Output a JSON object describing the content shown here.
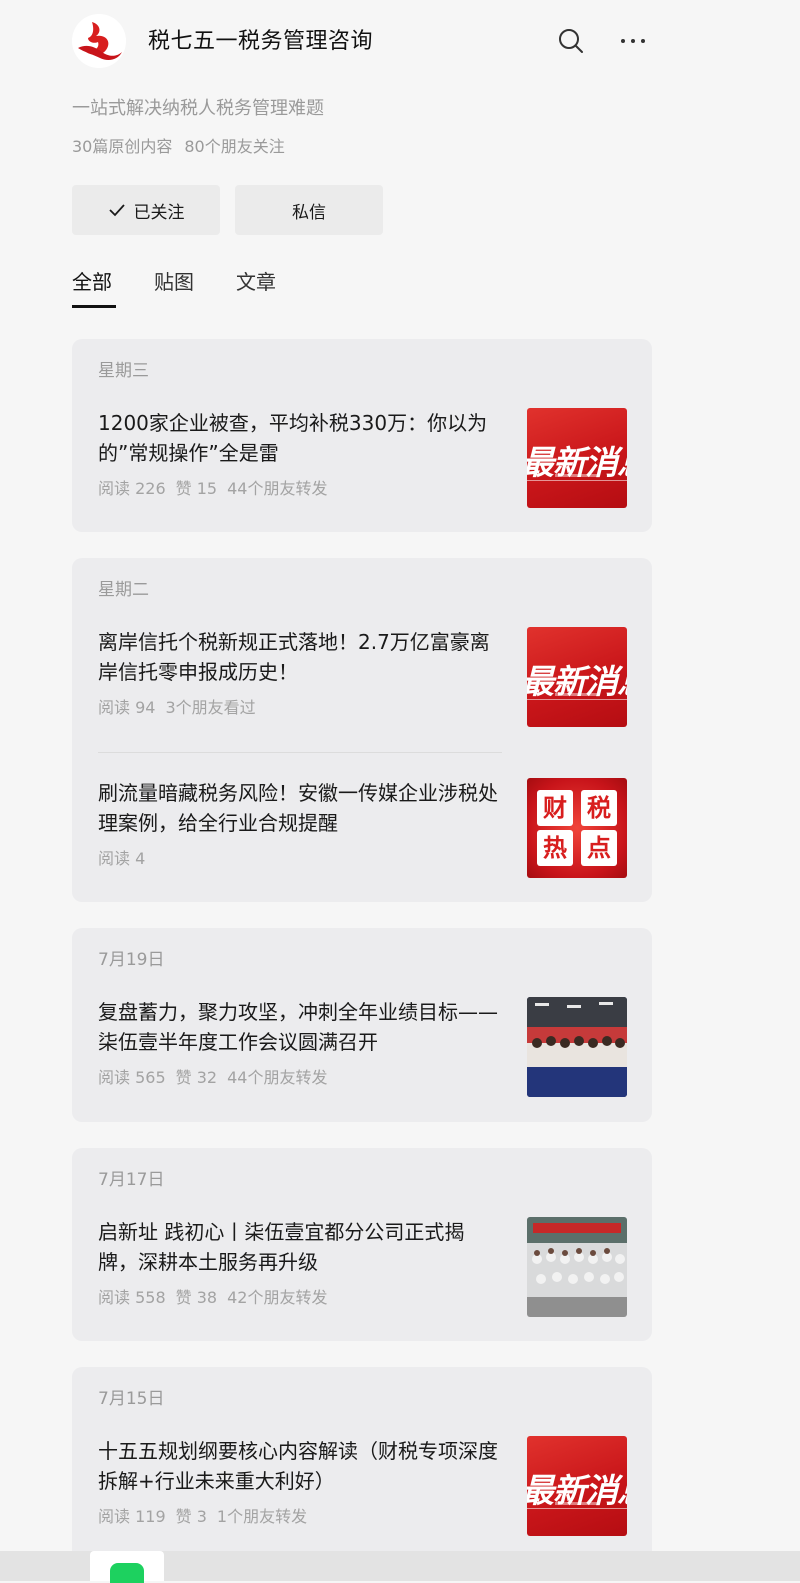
{
  "account": {
    "name": "税七五一税务管理咨询",
    "description": "一站式解决纳税人税务管理难题",
    "original_count": "30篇原创内容",
    "followers": "80个朋友关注"
  },
  "actions": {
    "follow_label": "已关注",
    "message_label": "私信"
  },
  "tabs": [
    {
      "label": "全部",
      "active": true
    },
    {
      "label": "贴图",
      "active": false
    },
    {
      "label": "文章",
      "active": false
    }
  ],
  "icons": {
    "search": "search-icon",
    "more": "more-icon",
    "check": "check-icon"
  },
  "colors": {
    "accent_red": "#d81e1e",
    "card_bg": "#ececee",
    "page_bg": "#f6f6f6",
    "meta_gray": "#a3a3a3"
  },
  "feed": [
    {
      "day": "星期三",
      "articles": [
        {
          "title": "1200家企业被查，平均补税330万：你以为的”常规操作”全是雷",
          "meta": [
            "阅读 226",
            "赞 15",
            "44个朋友转发"
          ],
          "thumb_text": "最新消息"
        }
      ]
    },
    {
      "day": "星期二",
      "articles": [
        {
          "title": "离岸信托个税新规正式落地！2.7万亿富豪离岸信托零申报成历史！",
          "meta": [
            "阅读 94",
            "3个朋友看过"
          ],
          "thumb_text": "最新消息"
        },
        {
          "title": "刷流量暗藏税务风险！安徽一传媒企业涉税处理案例，给全行业合规提醒",
          "meta": [
            "阅读 4"
          ],
          "thumb_text": [
            "财",
            "税",
            "热",
            "点"
          ]
        }
      ]
    },
    {
      "day": "7月19日",
      "articles": [
        {
          "title": "复盘蓄力，聚力攻坚，冲刺全年业绩目标——柒伍壹半年度工作会议圆满召开",
          "meta": [
            "阅读 565",
            "赞 32",
            "44个朋友转发"
          ]
        }
      ]
    },
    {
      "day": "7月17日",
      "articles": [
        {
          "title": "启新址 践初心丨柒伍壹宜都分公司正式揭牌，深耕本土服务再升级",
          "meta": [
            "阅读 558",
            "赞 38",
            "42个朋友转发"
          ]
        }
      ]
    },
    {
      "day": "7月15日",
      "articles": [
        {
          "title": "十五五规划纲要核心内容解读（财税专项深度拆解+行业未来重大利好）",
          "meta": [
            "阅读 119",
            "赞 3",
            "1个朋友转发"
          ],
          "thumb_text": "最新消息"
        }
      ]
    }
  ]
}
